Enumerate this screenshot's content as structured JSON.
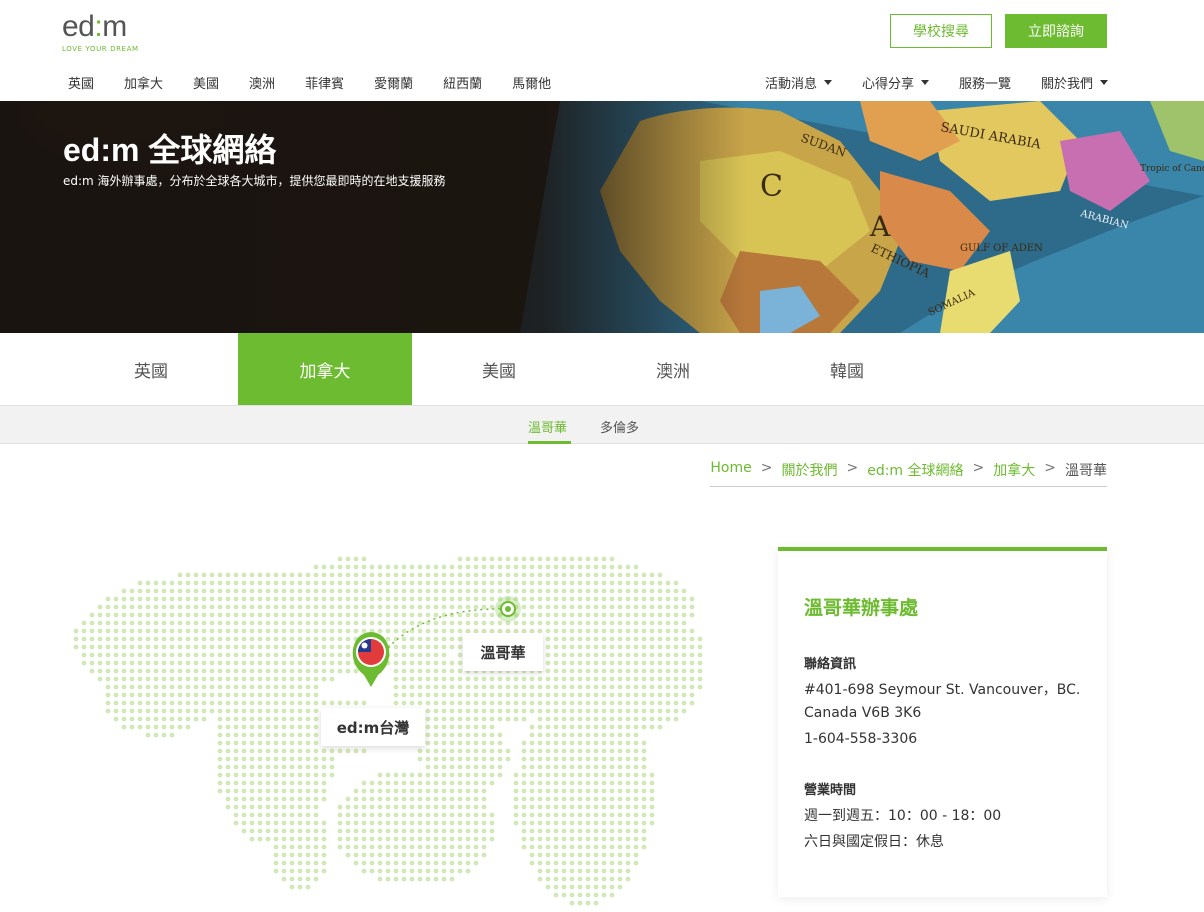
{
  "logo": {
    "text_left": "ed",
    "colon": ":",
    "text_right": "m",
    "tagline": "LOVE YOUR DREAM"
  },
  "header": {
    "search_label": "學校搜尋",
    "consult_label": "立即諮詢"
  },
  "nav_left": [
    "英國",
    "加拿大",
    "美國",
    "澳洲",
    "菲律賓",
    "愛爾蘭",
    "紐西蘭",
    "馬爾他"
  ],
  "nav_right": [
    {
      "label": "活動消息",
      "dropdown": true
    },
    {
      "label": "心得分享",
      "dropdown": true
    },
    {
      "label": "服務一覽",
      "dropdown": false
    },
    {
      "label": "關於我們",
      "dropdown": true
    }
  ],
  "banner": {
    "title": "ed:m 全球網絡",
    "subtitle": "ed:m 海外辦事處，分布於全球各大城市，提供您最即時的在地支援服務"
  },
  "country_tabs": [
    "英國",
    "加拿大",
    "美國",
    "澳洲",
    "韓國"
  ],
  "country_active": "加拿大",
  "city_tabs": [
    "溫哥華",
    "多倫多"
  ],
  "city_active": "溫哥華",
  "breadcrumb": [
    "Home",
    "關於我們",
    "ed:m 全球網絡",
    "加拿大",
    "溫哥華"
  ],
  "map": {
    "origin_label": "ed:m台灣",
    "destination_label": "溫哥華"
  },
  "office": {
    "title": "溫哥華辦事處",
    "contact_label": "聯絡資訊",
    "address_line1": "#401-698 Seymour St. Vancouver，BC.",
    "address_line2": "Canada V6B 3K6",
    "phone": "1-604-558-3306",
    "hours_label": "營業時間",
    "hours_weekday": "週一到週五：10：00 - 18：00",
    "hours_weekend": "六日與國定假日：休息"
  },
  "colors": {
    "accent": "#6dbb30",
    "map_dot": "#d3e8b8",
    "text": "#333333"
  }
}
